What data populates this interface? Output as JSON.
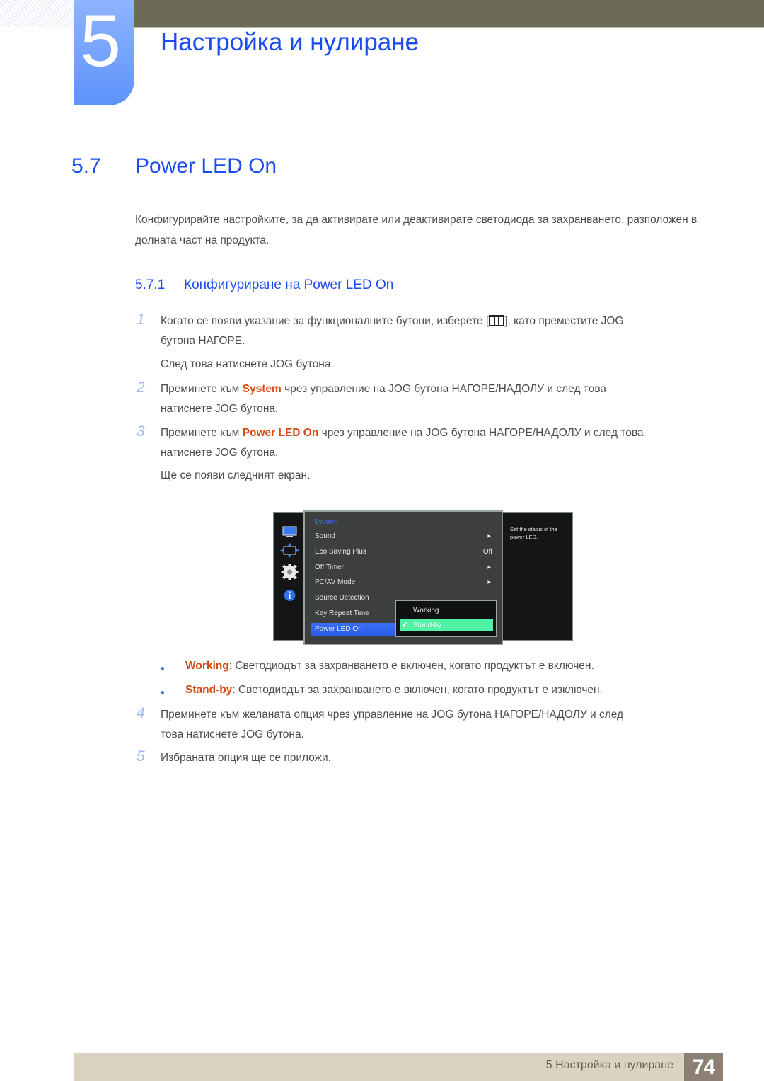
{
  "chapter": {
    "number": "5",
    "title": "Настройка и нулиране"
  },
  "section": {
    "number": "5.7",
    "title": "Power LED On",
    "intro": "Конфигурирайте настройките, за да активирате или деактивирате светодиода за захранването, разположен в долната част на продукта."
  },
  "subsection": {
    "number": "5.7.1",
    "title": "Конфигуриране на Power LED On"
  },
  "steps": [
    {
      "num": "1",
      "text_a": "Когато се появи указание за функционалните бутони, изберете [",
      "text_b": "], като преместите JOG",
      "line2": "бутона НАГОРЕ.",
      "note": "След това натиснете JOG бутона.",
      "icon": "menu-icon"
    },
    {
      "num": "2",
      "pre": "Преминете към ",
      "hl": "System",
      "post": " чрез управление на JOG бутона НАГОРЕ/НАДОЛУ и след това",
      "line2": "натиснете JOG бутона."
    },
    {
      "num": "3",
      "pre": "Преминете към ",
      "hl": "Power LED On",
      "post": " чрез управление на JOG бутона НАГОРЕ/НАДОЛУ и след това",
      "line2": "натиснете JOG бутона.",
      "note": "Ще се появи следният екран."
    },
    {
      "num": "4",
      "text": "Преминете към желаната опция чрез управление на JOG бутона НАГОРЕ/НАДОЛУ и след",
      "line2": "това натиснете JOG бутона."
    },
    {
      "num": "5",
      "text": "Избраната опция ще се приложи."
    }
  ],
  "osd": {
    "sidebar_icons": [
      "monitor-icon",
      "resize-arrows-icon",
      "gear-icon",
      "info-icon"
    ],
    "category": "System",
    "items": [
      {
        "label": "Sound",
        "value": "",
        "arrow": true
      },
      {
        "label": "Eco Saving Plus",
        "value": "Off",
        "arrow": false
      },
      {
        "label": "Off Timer",
        "value": "",
        "arrow": true
      },
      {
        "label": "PC/AV Mode",
        "value": "",
        "arrow": true
      },
      {
        "label": "Source Detection",
        "value": "",
        "arrow": false
      },
      {
        "label": "Key Repeat Time",
        "value": "",
        "arrow": false
      },
      {
        "label": "Power LED On",
        "value": "",
        "arrow": false,
        "selected": true
      }
    ],
    "submenu": [
      {
        "label": "Working",
        "selected": false
      },
      {
        "label": "Stand-by",
        "selected": true
      }
    ],
    "help": "Set the status of the power LED.",
    "colors": {
      "category": "#3e6ff0",
      "selected": "#2a5ce8",
      "submenu_selected": "#52f2a6"
    }
  },
  "options": [
    {
      "name": "Working",
      "desc": ": Светодиодът за захранването е включен, когато продуктът е включен."
    },
    {
      "name": "Stand-by",
      "desc": ": Светодиодът за захранването е включен, когато продуктът е изключен."
    }
  ],
  "footer": {
    "text": "5 Настройка и нулиране",
    "page": "74"
  },
  "colors": {
    "heading": "#1a4cf0",
    "highlight": "#d64a12",
    "step_number": "#9fb8ee",
    "topbar": "#6d6b57",
    "footer": "#d9d4c1",
    "page_badge": "#8c8075"
  }
}
